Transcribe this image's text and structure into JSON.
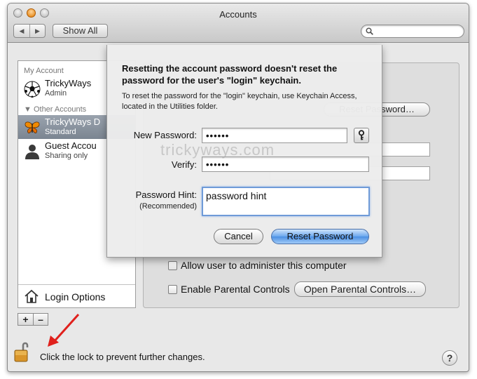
{
  "window": {
    "title": "Accounts"
  },
  "toolbar": {
    "back_icon": "chevron-left-icon",
    "forward_icon": "chevron-right-icon",
    "show_all_label": "Show All",
    "search_placeholder": ""
  },
  "sidebar": {
    "my_account_header": "My Account",
    "other_accounts_header": "Other Accounts",
    "accounts": [
      {
        "name": "TrickyWays",
        "role": "Admin",
        "icon": "soccer-ball-icon"
      },
      {
        "name": "TrickyWays D",
        "role": "Standard",
        "icon": "butterfly-icon",
        "selected": true
      },
      {
        "name": "Guest Accou",
        "role": "Sharing only",
        "icon": "person-silhouette-icon"
      }
    ],
    "login_options_label": "Login Options",
    "add_label": "+",
    "remove_label": "–"
  },
  "panel": {
    "reset_password_button": "Reset Password…",
    "allow_admin_label": "Allow user to administer this computer",
    "parental_label": "Enable Parental Controls",
    "open_parental_button": "Open Parental Controls…"
  },
  "sheet": {
    "title": "Resetting the account password doesn't reset the password for the user's \"login\" keychain.",
    "description": "To reset the password for the \"login\" keychain, use Keychain Access, located in the Utilities folder.",
    "new_password_label": "New Password:",
    "new_password_value": "••••••",
    "verify_label": "Verify:",
    "verify_value": "••••••",
    "hint_label": "Password Hint:",
    "hint_sublabel": "(Recommended)",
    "hint_value": "password hint",
    "cancel_label": "Cancel",
    "reset_label": "Reset Password"
  },
  "footer": {
    "lock_text": "Click the lock to prevent further changes.",
    "help_label": "?"
  },
  "watermark": "trickyways.com",
  "colors": {
    "accent": "#4b8fe3",
    "selection": "#7b8591",
    "arrow": "#e0201c"
  }
}
